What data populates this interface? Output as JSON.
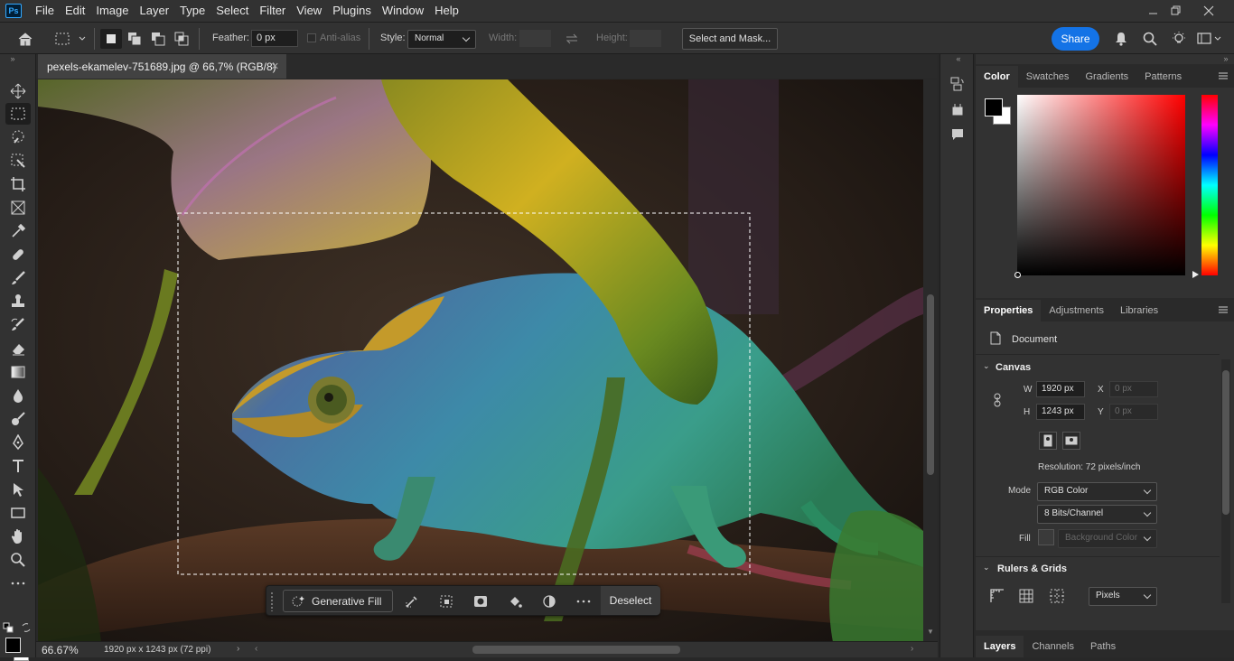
{
  "app": {
    "logo": "Ps"
  },
  "menu": [
    "File",
    "Edit",
    "Image",
    "Layer",
    "Type",
    "Select",
    "Filter",
    "View",
    "Plugins",
    "Window",
    "Help"
  ],
  "options": {
    "feather_label": "Feather:",
    "feather_value": "0 px",
    "antialias_label": "Anti-alias",
    "style_label": "Style:",
    "style_value": "Normal",
    "width_label": "Width:",
    "height_label": "Height:",
    "select_mask_label": "Select and Mask...",
    "share_label": "Share"
  },
  "document": {
    "tab_title": "pexels-ekamelev-751689.jpg @ 66,7% (RGB/8)",
    "zoom": "66.67%",
    "info": "1920 px x 1243 px (72 ppi)"
  },
  "context_bar": {
    "generative_fill": "Generative Fill",
    "deselect": "Deselect"
  },
  "color_panel": {
    "tabs": [
      "Color",
      "Swatches",
      "Gradients",
      "Patterns"
    ],
    "foreground": "#000000",
    "background": "#ffffff",
    "hue": "#ff0000"
  },
  "properties_panel": {
    "tabs": [
      "Properties",
      "Adjustments",
      "Libraries"
    ],
    "doc_label": "Document",
    "canvas_title": "Canvas",
    "w_label": "W",
    "w_value": "1920 px",
    "h_label": "H",
    "h_value": "1243 px",
    "x_label": "X",
    "x_value": "0 px",
    "y_label": "Y",
    "y_value": "0 px",
    "resolution": "Resolution: 72 pixels/inch",
    "mode_label": "Mode",
    "mode_value": "RGB Color",
    "bits_value": "8 Bits/Channel",
    "fill_label": "Fill",
    "fill_value": "Background Color",
    "rulers_title": "Rulers & Grids",
    "units_value": "Pixels"
  },
  "layers_panel": {
    "tabs": [
      "Layers",
      "Channels",
      "Paths"
    ]
  },
  "colors": {
    "accent": "#1473e6",
    "panel": "#323232",
    "dark": "#1e1e1e"
  }
}
